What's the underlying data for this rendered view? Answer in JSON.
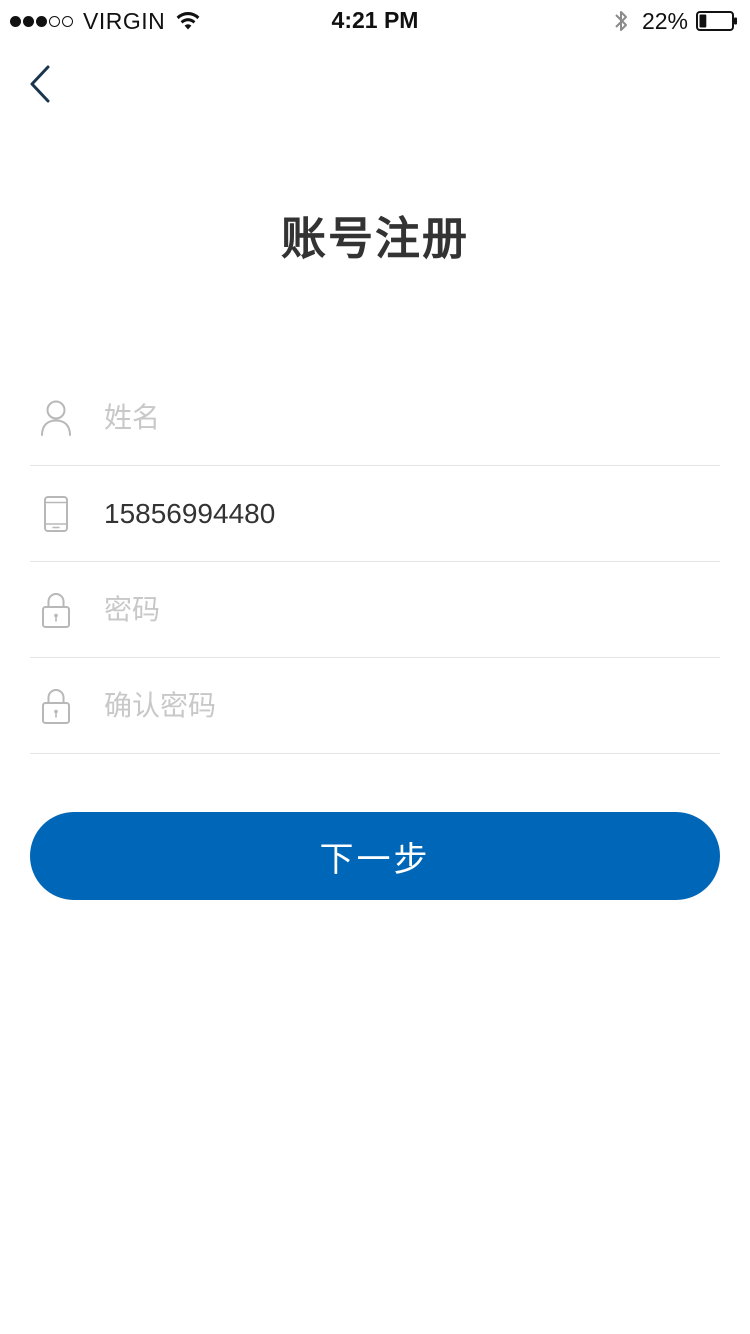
{
  "status_bar": {
    "signal_filled": 3,
    "signal_total": 5,
    "carrier": "VIRGIN",
    "time": "4:21 PM",
    "battery_percent": "22%",
    "battery_level": 0.22,
    "icons": [
      "wifi-icon",
      "bluetooth-icon",
      "battery-icon"
    ]
  },
  "nav": {
    "back_icon": "chevron-left-icon"
  },
  "page": {
    "title": "账号注册"
  },
  "form": {
    "fields": [
      {
        "name": "name",
        "icon": "user-icon",
        "value": "",
        "placeholder": "姓名"
      },
      {
        "name": "phone",
        "icon": "phone-icon",
        "value": "15856994480",
        "placeholder": ""
      },
      {
        "name": "password",
        "icon": "lock-icon",
        "value": "",
        "placeholder": "密码"
      },
      {
        "name": "confirm_password",
        "icon": "lock-icon",
        "value": "",
        "placeholder": "确认密码"
      }
    ]
  },
  "actions": {
    "next_label": "下一步"
  },
  "colors": {
    "primary": "#0066b8",
    "title_text": "#333333",
    "placeholder": "#c8c8c8",
    "divider": "#e5e5e5",
    "icon": "#b8b8b8",
    "back_icon": "#1a3550"
  }
}
